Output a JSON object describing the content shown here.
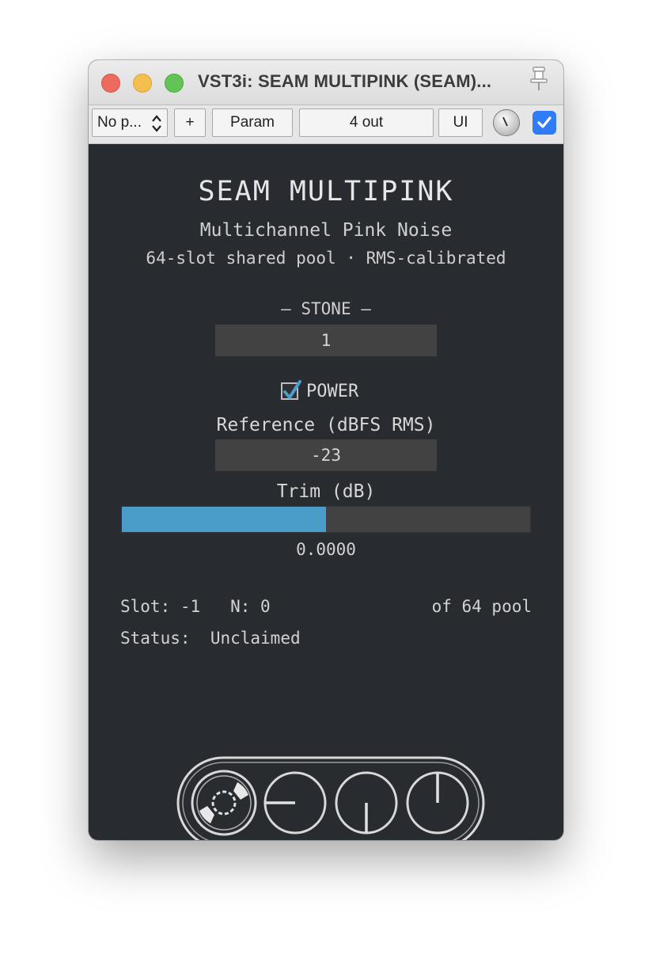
{
  "window": {
    "title": "VST3i: SEAM MULTIPINK (SEAM)..."
  },
  "toolbar": {
    "preset_label": "No p...",
    "add_label": "+",
    "param_label": "Param",
    "io_label": "4 out",
    "ui_label": "UI",
    "enabled": true
  },
  "plugin": {
    "name": "SEAM MULTIPINK",
    "subtitle": "Multichannel Pink Noise",
    "tagline": "64-slot shared pool · RMS-calibrated",
    "stone_label": "— STONE —",
    "stone_value": "1",
    "power_label": "POWER",
    "power_on": true,
    "reference_label": "Reference (dBFS RMS)",
    "reference_value": "-23",
    "trim_label": "Trim (dB)",
    "trim_value": "0.0000",
    "trim_fill_fraction": 0.5,
    "slot_label": "Slot: -1",
    "n_label": "N: 0",
    "pool_label": "of 64 pool",
    "status_label": "Status:",
    "status_value": "Unclaimed"
  },
  "colors": {
    "panel_bg": "#282b2f",
    "field_bg": "#424242",
    "accent": "#4a9dc8",
    "checkbox_blue": "#2f7cf6"
  }
}
